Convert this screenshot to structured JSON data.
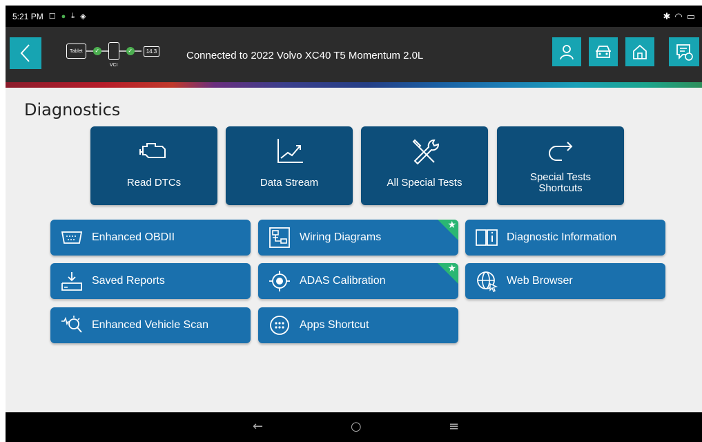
{
  "status_bar": {
    "time": "5:21 PM",
    "right_icons": "bluetooth wifi battery"
  },
  "header": {
    "connection": {
      "tablet_label": "Tablet",
      "vci_label": "VCI",
      "battery_voltage": "14.3"
    },
    "connection_text": "Connected to 2022 Volvo XC40 T5 Momentum 2.0L"
  },
  "page": {
    "title": "Diagnostics"
  },
  "primary_tiles": [
    {
      "label": "Read DTCs",
      "icon": "engine-icon"
    },
    {
      "label": "Data Stream",
      "icon": "chart-icon"
    },
    {
      "label": "All Special Tests",
      "icon": "tools-icon"
    },
    {
      "label": "Special Tests\nShortcuts",
      "icon": "redirect-arrow-icon"
    }
  ],
  "secondary_tiles": [
    {
      "label": "Enhanced OBDII",
      "icon": "obd-connector-icon",
      "favorite": false
    },
    {
      "label": "Wiring Diagrams",
      "icon": "wiring-diagram-icon",
      "favorite": true
    },
    {
      "label": "Diagnostic Information",
      "icon": "book-info-icon",
      "favorite": false
    },
    {
      "label": "Saved Reports",
      "icon": "download-tray-icon",
      "favorite": false
    },
    {
      "label": "ADAS Calibration",
      "icon": "target-icon",
      "favorite": true
    },
    {
      "label": "Web Browser",
      "icon": "globe-icon",
      "favorite": false
    },
    {
      "label": "Enhanced Vehicle Scan",
      "icon": "scan-search-icon",
      "favorite": false
    },
    {
      "label": "Apps Shortcut",
      "icon": "apps-grid-icon",
      "favorite": false
    }
  ],
  "colors": {
    "primary_tile": "#0d4e7a",
    "secondary_tile": "#1a70ad",
    "accent": "#17a4b2",
    "favorite": "#2bb673"
  }
}
